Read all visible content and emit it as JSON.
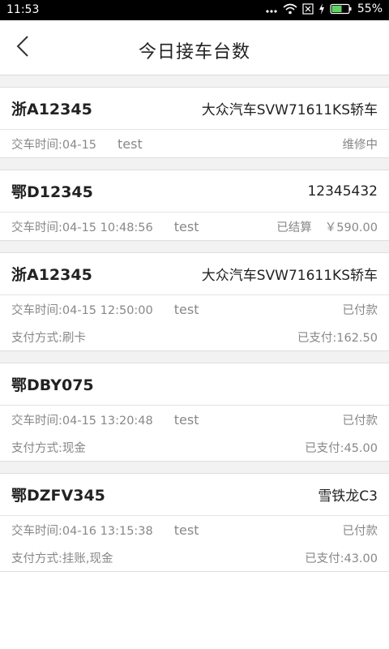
{
  "status_bar": {
    "time": "11:53",
    "battery": "55%",
    "icons": [
      "dots-icon",
      "wifi-icon",
      "sim-icon",
      "charging-icon",
      "battery-icon"
    ]
  },
  "header": {
    "title": "今日接车台数",
    "back_icon": "chevron-left-icon"
  },
  "orders": [
    {
      "plate": "浙A12345",
      "model": "大众汽车SVW71611KS轿车",
      "delivery_time": "交车时间:04-15",
      "user": "test",
      "status": "维修中",
      "price": "",
      "payment_method": "",
      "paid_amount": ""
    },
    {
      "plate": "鄂D12345",
      "model": "12345432",
      "delivery_time": "交车时间:04-15 10:48:56",
      "user": "test",
      "status": "已结算",
      "price": "￥590.00",
      "payment_method": "",
      "paid_amount": ""
    },
    {
      "plate": "浙A12345",
      "model": "大众汽车SVW71611KS轿车",
      "delivery_time": "交车时间:04-15 12:50:00",
      "user": "test",
      "status": "已付款",
      "price": "",
      "payment_method": "支付方式:刷卡",
      "paid_amount": "已支付:162.50"
    },
    {
      "plate": "鄂DBY075",
      "model": "",
      "delivery_time": "交车时间:04-15 13:20:48",
      "user": "test",
      "status": "已付款",
      "price": "",
      "payment_method": "支付方式:现金",
      "paid_amount": "已支付:45.00"
    },
    {
      "plate": "鄂DZFV345",
      "model": "雪铁龙C3",
      "delivery_time": "交车时间:04-16 13:15:38",
      "user": "test",
      "status": "已付款",
      "price": "",
      "payment_method": "支付方式:挂账,现金",
      "paid_amount": "已支付:43.00"
    }
  ]
}
